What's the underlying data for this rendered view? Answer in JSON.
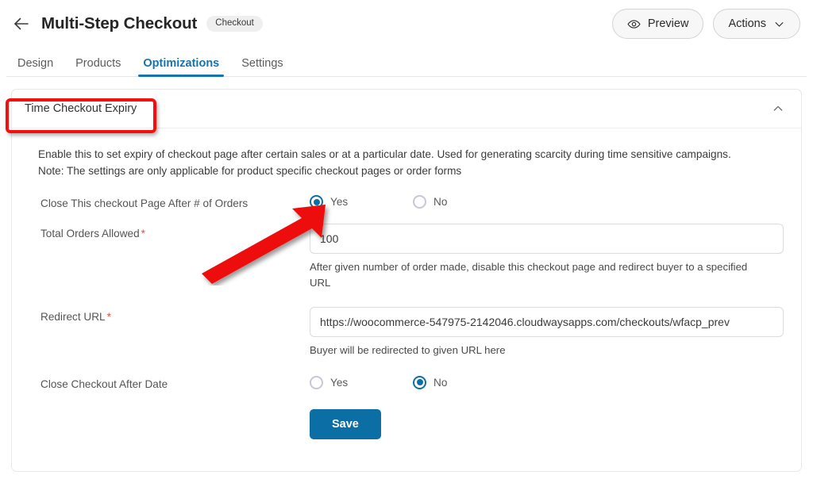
{
  "header": {
    "back_icon": "arrow-left-icon",
    "title": "Multi-Step Checkout",
    "badge": "Checkout",
    "preview_label": "Preview",
    "preview_icon": "eye-icon",
    "actions_label": "Actions",
    "actions_icon": "chevron-down-icon"
  },
  "tabs": [
    {
      "label": "Design",
      "active": false
    },
    {
      "label": "Products",
      "active": false
    },
    {
      "label": "Optimizations",
      "active": true
    },
    {
      "label": "Settings",
      "active": false
    }
  ],
  "panel": {
    "title": "Time Checkout Expiry",
    "collapse_icon": "chevron-up-icon",
    "description_line1": "Enable this to set expiry of checkout page after certain sales or at a particular date. Used for generating scarcity during time sensitive campaigns.",
    "description_line2": "Note: The settings are only applicable for product specific checkout pages or order forms",
    "fields": {
      "close_after_orders": {
        "label": "Close This checkout Page After # of Orders",
        "options": [
          "Yes",
          "No"
        ],
        "selected": "Yes"
      },
      "total_orders": {
        "label": "Total Orders Allowed",
        "required_marker": "*",
        "value": "100",
        "hint": "After given number of order made, disable this checkout page and redirect buyer to a specified URL"
      },
      "redirect_url": {
        "label": "Redirect URL",
        "required_marker": "*",
        "value": "https://woocommerce-547975-2142046.cloudwaysapps.com/checkouts/wfacp_prev",
        "hint": "Buyer will be redirected to given URL here"
      },
      "close_after_date": {
        "label": "Close Checkout After Date",
        "options": [
          "Yes",
          "No"
        ],
        "selected": "No"
      }
    },
    "save_label": "Save"
  },
  "annotations": {
    "highlight_color": "#f40f0f",
    "arrow_color": "#ee1111",
    "highlight_target": "Time Checkout Expiry",
    "arrow_target": "Yes radio for Close This checkout Page After # of Orders"
  },
  "colors": {
    "accent": "#1574ad",
    "save_button": "#0b6ea4",
    "radio_selected": "#0d6fa8",
    "required_asterisk": "#e8503a"
  }
}
